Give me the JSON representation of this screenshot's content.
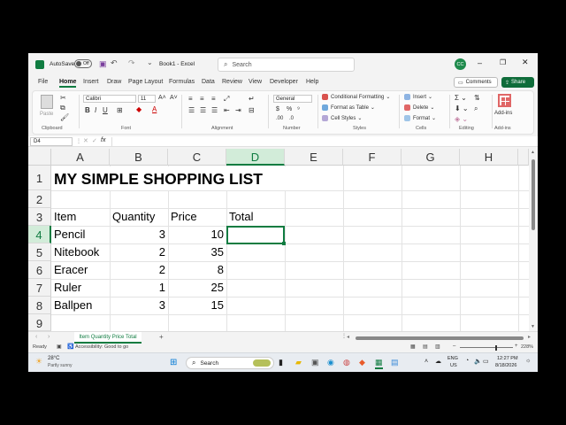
{
  "title": {
    "autosave_label": "AutoSave",
    "autosave_state": "Off",
    "doc_name": "Book1 - Excel",
    "search_placeholder": "Search",
    "avatar_initials": "CC"
  },
  "tabs": [
    "File",
    "Home",
    "Insert",
    "Draw",
    "Page Layout",
    "Formulas",
    "Data",
    "Review",
    "View",
    "Developer",
    "Help"
  ],
  "actions": {
    "comments": "Comments",
    "share": "Share"
  },
  "ribbon": {
    "paste": "Paste",
    "font_name": "Calibri",
    "font_size": "11",
    "number_format": "General",
    "conditional_formatting": "Conditional Formatting",
    "format_as_table": "Format as Table",
    "cell_styles": "Cell Styles",
    "insert": "Insert",
    "delete": "Delete",
    "format": "Format",
    "addins": "Add-ins",
    "groups": [
      "Clipboard",
      "Font",
      "Alignment",
      "Number",
      "Styles",
      "Cells",
      "Editing",
      "Add-ins"
    ]
  },
  "formula_bar": {
    "name_box": "D4",
    "fx": "fx",
    "value": ""
  },
  "columns": [
    "A",
    "B",
    "C",
    "D",
    "E",
    "F",
    "G",
    "H"
  ],
  "rows": [
    "1",
    "2",
    "3",
    "4",
    "5",
    "6",
    "7",
    "8",
    "9"
  ],
  "sheet": {
    "title": "MY SIMPLE SHOPPING LIST",
    "headers": [
      "Item",
      "Quantity",
      "Price",
      "Total"
    ],
    "items": [
      {
        "item": "Pencil",
        "qty": "3",
        "price": "10"
      },
      {
        "item": "Nitebook",
        "qty": "2",
        "price": "35"
      },
      {
        "item": "Eracer",
        "qty": "2",
        "price": "8"
      },
      {
        "item": "Ruler",
        "qty": "1",
        "price": "25"
      },
      {
        "item": "Ballpen",
        "qty": "3",
        "price": "15"
      }
    ]
  },
  "sheet_tab": "Item Quantity Price Total",
  "status": {
    "ready": "Ready",
    "accessibility": "Accessibility: Good to go",
    "zoom": "228%"
  },
  "taskbar": {
    "weather_temp": "28°C",
    "weather_desc": "Partly sunny",
    "search": "Search",
    "lang": "ENG",
    "region": "US",
    "time": "12:27 PM",
    "date": "8/18/2026"
  },
  "colors": {
    "accent": "#107c41",
    "share": "#0f6c3a"
  }
}
